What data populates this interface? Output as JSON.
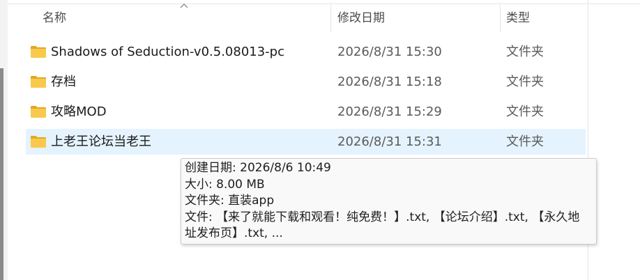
{
  "columns": {
    "name": "名称",
    "date_modified": "修改日期",
    "type": "类型"
  },
  "sort_indicator": "chevron-up-icon",
  "files": [
    {
      "name": "Shadows of Seduction-v0.5.08013-pc",
      "date_modified": "2026/8/31 15:30",
      "type": "文件夹",
      "icon": "folder-icon"
    },
    {
      "name": "存档",
      "date_modified": "2026/8/31 15:18",
      "type": "文件夹",
      "icon": "folder-icon"
    },
    {
      "name": "攻略MOD",
      "date_modified": "2026/8/31 15:29",
      "type": "文件夹",
      "icon": "folder-icon"
    },
    {
      "name": "上老王论坛当老王",
      "date_modified": "2026/8/31 15:31",
      "type": "文件夹",
      "icon": "folder-icon",
      "selected": true
    }
  ],
  "tooltip": {
    "created": "创建日期: 2026/8/6 10:49",
    "size": "大小: 8.00 MB",
    "folders": "文件夹: 直装app",
    "files_line1": "文件: 【来了就能下载和观看！纯免费！】.txt, 【论坛介绍】.txt, 【永久地",
    "files_line2": "址发布页】.txt, ..."
  },
  "colors": {
    "selection": "#e5f3ff",
    "folder_fill": "#f8c94c",
    "folder_tab": "#e3a820"
  }
}
